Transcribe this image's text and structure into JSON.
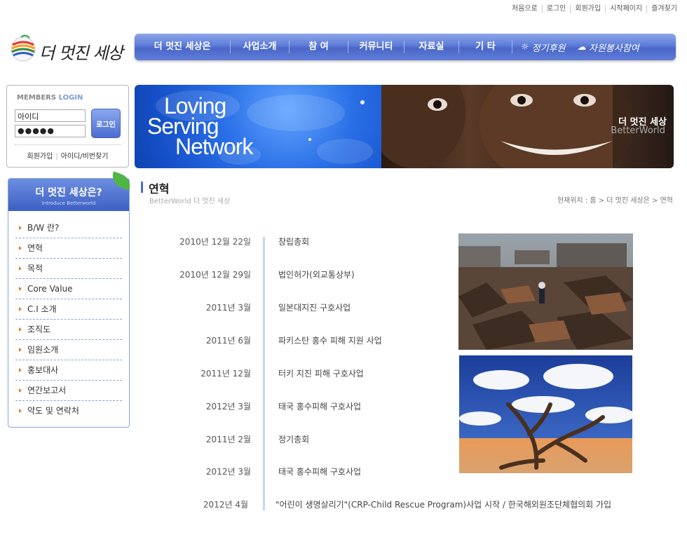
{
  "top_links": [
    "처음으로",
    "로그인",
    "회원가입",
    "시작페이지",
    "즐겨찾기"
  ],
  "logo": {
    "text": "더 멋진 세상",
    "small": "BetterWorld"
  },
  "main_nav": [
    "더 멋진 세상은",
    "사업소개",
    "참  여",
    "커뮤니티",
    "자료실",
    "기  타"
  ],
  "special_nav": {
    "regular_donation": "정기후원",
    "volunteer": "자원봉사참여"
  },
  "login": {
    "title_members": "MEMBERS",
    "title_login": "LOGIN",
    "id_value": "아이디",
    "password_mask": "●●●●●",
    "button": "로그인",
    "join": "회원가입",
    "find": "아이디/비번찾기"
  },
  "banner": {
    "line1": "Loving",
    "line2": "Serving",
    "line3": "Network",
    "brand_ko": "더 멋진 세상",
    "brand_en": "BetterWorld"
  },
  "side_menu": {
    "title": "더 멋진 세상은?",
    "subtitle": "Introduce Betterworld",
    "items": [
      "B/W 란?",
      "연혁",
      "목적",
      "Core Value",
      "C.I 소개",
      "조직도",
      "임원소개",
      "홍보대사",
      "연간보고서",
      "약도 및 연락처"
    ]
  },
  "content": {
    "title": "연혁",
    "subtitle": "BetterWorld 더 멋진 세상",
    "breadcrumb": "현재위치 : 홈 >  더 멋진 세상은 > 연혁"
  },
  "timeline": [
    {
      "date": "2010년 12월 22일",
      "event": "창립총회"
    },
    {
      "date": "2010년 12월 29일",
      "event": "법인허가(외교통상부)"
    },
    {
      "date": "2011년 3월",
      "event": "일본대지진 구호사업"
    },
    {
      "date": "2011년 6월",
      "event": "파키스탄 홍수 피해 지원 사업"
    },
    {
      "date": "2011년 12월",
      "event": "터키 지진 피해 구호사업"
    },
    {
      "date": "2012년 3월",
      "event": "태국 홍수피해 구호사업"
    },
    {
      "date": "2011년 2월",
      "event": "정기총회"
    },
    {
      "date": "2012년 3월",
      "event": "태국 홍수피해 구호사업"
    },
    {
      "date": "2012년 4월",
      "event": "\"어린이 생명살리기\"(CRP-Child Rescue Program)사업 시작 / 한국해외원조단체협의회 가입"
    }
  ]
}
